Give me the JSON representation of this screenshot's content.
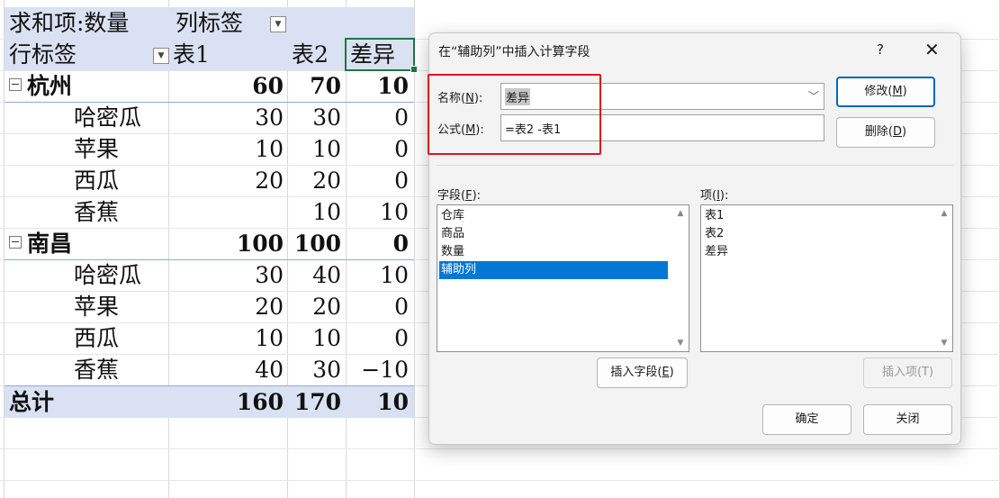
{
  "pivot": {
    "header_row1": {
      "label": "求和项:数量",
      "col_label": "列标签"
    },
    "header_row2": {
      "row_label": "行标签",
      "col1": "表1",
      "col2": "表2",
      "col3": "差异"
    },
    "rows": [
      {
        "label": "杭州",
        "t1": "60",
        "t2": "70",
        "diff": "10",
        "level": "group"
      },
      {
        "label": "哈密瓜",
        "t1": "30",
        "t2": "30",
        "diff": "0",
        "level": "item"
      },
      {
        "label": "苹果",
        "t1": "10",
        "t2": "10",
        "diff": "0",
        "level": "item"
      },
      {
        "label": "西瓜",
        "t1": "20",
        "t2": "20",
        "diff": "0",
        "level": "item"
      },
      {
        "label": "香蕉",
        "t1": "",
        "t2": "10",
        "diff": "10",
        "level": "item"
      },
      {
        "label": "南昌",
        "t1": "100",
        "t2": "100",
        "diff": "0",
        "level": "group"
      },
      {
        "label": "哈密瓜",
        "t1": "30",
        "t2": "40",
        "diff": "10",
        "level": "item"
      },
      {
        "label": "苹果",
        "t1": "20",
        "t2": "20",
        "diff": "0",
        "level": "item"
      },
      {
        "label": "西瓜",
        "t1": "10",
        "t2": "10",
        "diff": "0",
        "level": "item"
      },
      {
        "label": "香蕉",
        "t1": "40",
        "t2": "30",
        "diff": "−10",
        "level": "item"
      }
    ],
    "total": {
      "label": "总计",
      "t1": "160",
      "t2": "170",
      "diff": "10"
    }
  },
  "dialog": {
    "title": "在“辅助列”中插入计算字段",
    "help": "?",
    "close": "✕",
    "name_label_pre": "名称(",
    "name_label_key": "N",
    "name_label_post": "):",
    "name_value": "差异",
    "formula_label_pre": "公式(",
    "formula_label_key": "M",
    "formula_label_post": "):",
    "formula_value": "=表2 -表1",
    "modify_pre": "修改(",
    "modify_key": "M",
    "modify_post": ")",
    "delete_pre": "删除(",
    "delete_key": "D",
    "delete_post": ")",
    "fields_label_pre": "字段(",
    "fields_label_key": "F",
    "fields_label_post": "):",
    "fields": [
      "仓库",
      "商品",
      "数量",
      "辅助列"
    ],
    "selected_field_index": 3,
    "items_label_pre": "项(",
    "items_label_key": "I",
    "items_label_post": "):",
    "items": [
      "表1",
      "表2",
      "差异"
    ],
    "insert_field_pre": "插入字段(",
    "insert_field_key": "E",
    "insert_field_post": ")",
    "insert_item": "插入项(T)",
    "ok": "确定",
    "cancel": "关闭"
  },
  "colors": {
    "pivot_header": "#d9e1f2",
    "selection": "#217346",
    "list_selected": "#0078d4",
    "annotation_box": "#e0121e"
  }
}
